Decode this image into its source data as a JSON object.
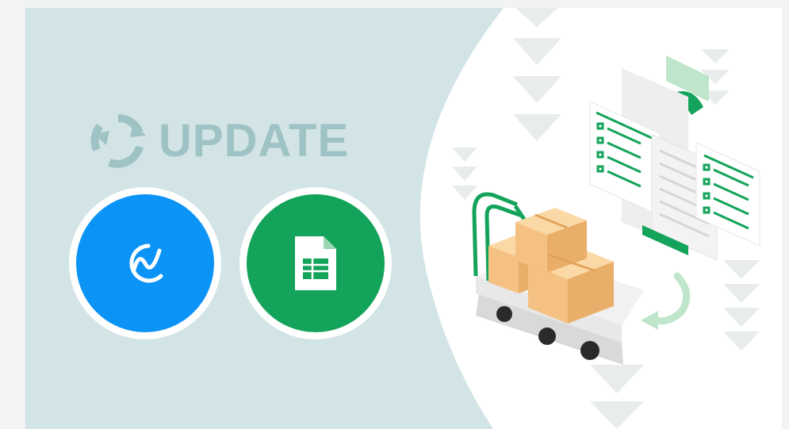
{
  "title": {
    "text": "UPDATE",
    "icon": "refresh-icon"
  },
  "logos": [
    {
      "name": "app-logo",
      "icon": "wave-logo-icon",
      "color": "#0b93f6"
    },
    {
      "name": "sheets-logo",
      "icon": "spreadsheet-icon",
      "color": "#14a35a"
    }
  ],
  "illustration": {
    "subject": "hand-truck-with-boxes",
    "document_icon": "spreadsheet-documents",
    "decor": "down-arrow-chevrons"
  },
  "colors": {
    "panel": "#d2e4e6",
    "title": "#9fc2c5",
    "blue": "#0b93f6",
    "green": "#14a35a",
    "box": "#f5c98c",
    "chevron": "#e9ecec"
  }
}
